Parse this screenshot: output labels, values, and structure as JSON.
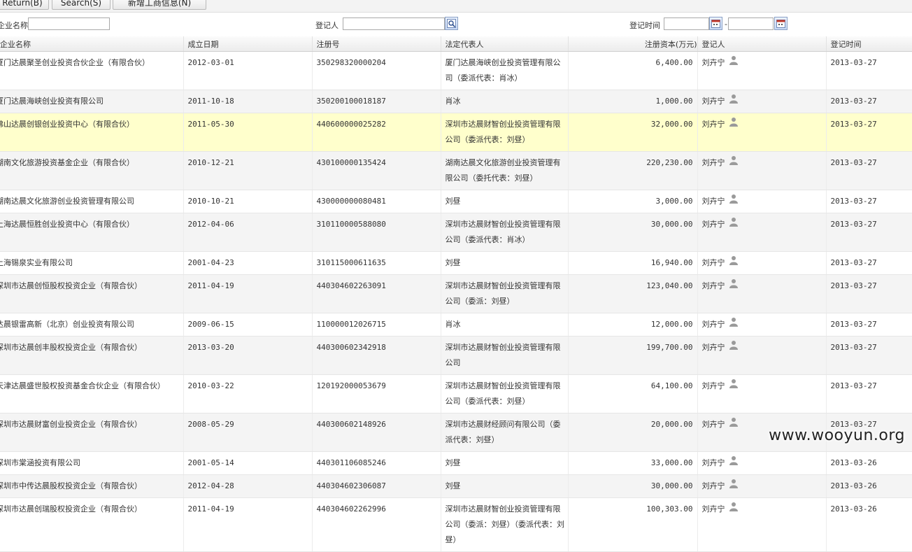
{
  "toolbar": {
    "return_label": "Return(B)",
    "search_label": "Search(S)",
    "add_label": "新增工商信息(N)"
  },
  "filters": {
    "company_label": "企业名称",
    "registrant_label": "登记人",
    "reg_time_label": "登记时间",
    "range_sep": "-"
  },
  "columns": [
    "企业名称",
    "成立日期",
    "注册号",
    "法定代表人",
    "注册资本(万元)",
    "登记人",
    "登记时间"
  ],
  "rows": [
    {
      "name": "厦门达晨聚圣创业投资合伙企业（有限合伙）",
      "date": "2012-03-01",
      "regno": "350298320000204",
      "rep": "厦门达晨海峡创业投资管理有限公司（委派代表：肖冰）",
      "capital": "6,400.00",
      "registrant": "刘卉宁",
      "time": "2013-03-27"
    },
    {
      "name": "厦门达晨海峡创业投资有限公司",
      "date": "2011-10-18",
      "regno": "350200100018187",
      "rep": "肖冰",
      "capital": "1,000.00",
      "registrant": "刘卉宁",
      "time": "2013-03-27"
    },
    {
      "name": "佛山达晨创银创业投资中心（有限合伙）",
      "date": "2011-05-30",
      "regno": "440600000025282",
      "rep": "深圳市达晨财智创业投资管理有限公司（委派代表：刘昼）",
      "capital": "32,000.00",
      "registrant": "刘卉宁",
      "time": "2013-03-27"
    },
    {
      "name": "湖南文化旅游投资基金企业（有限合伙）",
      "date": "2010-12-21",
      "regno": "430100000135424",
      "rep": "湖南达晨文化旅游创业投资管理有限公司（委托代表：刘昼）",
      "capital": "220,230.00",
      "registrant": "刘卉宁",
      "time": "2013-03-27"
    },
    {
      "name": "湖南达晨文化旅游创业投资管理有限公司",
      "date": "2010-10-21",
      "regno": "430000000080481",
      "rep": "刘昼",
      "capital": "3,000.00",
      "registrant": "刘卉宁",
      "time": "2013-03-27"
    },
    {
      "name": "上海达晨恒胜创业投资中心（有限合伙）",
      "date": "2012-04-06",
      "regno": "310110000588080",
      "rep": "深圳市达晨财智创业投资管理有限公司（委派代表：肖冰）",
      "capital": "30,000.00",
      "registrant": "刘卉宁",
      "time": "2013-03-27"
    },
    {
      "name": "上海锡泉实业有限公司",
      "date": "2001-04-23",
      "regno": "310115000611635",
      "rep": "刘昼",
      "capital": "16,940.00",
      "registrant": "刘卉宁",
      "time": "2013-03-27"
    },
    {
      "name": "深圳市达晨创恒股权投资企业（有限合伙）",
      "date": "2011-04-19",
      "regno": "440304602263091",
      "rep": "深圳市达晨财智创业投资管理有限公司（委派：刘昼）",
      "capital": "123,040.00",
      "registrant": "刘卉宁",
      "time": "2013-03-27"
    },
    {
      "name": "达晨银雷高新（北京）创业投资有限公司",
      "date": "2009-06-15",
      "regno": "110000012026715",
      "rep": "肖冰",
      "capital": "12,000.00",
      "registrant": "刘卉宁",
      "time": "2013-03-27"
    },
    {
      "name": "深圳市达晨创丰股权投资企业（有限合伙）",
      "date": "2013-03-20",
      "regno": "440300602342918",
      "rep": "深圳市达晨财智创业投资管理有限公司",
      "capital": "199,700.00",
      "registrant": "刘卉宁",
      "time": "2013-03-27"
    },
    {
      "name": "天津达晨盛世股权投资基金合伙企业（有限合伙）",
      "date": "2010-03-22",
      "regno": "120192000053679",
      "rep": "深圳市达晨财智创业投资管理有限公司（委派代表：刘昼）",
      "capital": "64,100.00",
      "registrant": "刘卉宁",
      "time": "2013-03-27"
    },
    {
      "name": "深圳市达晨财富创业投资企业（有限合伙）",
      "date": "2008-05-29",
      "regno": "440300602148926",
      "rep": "深圳市达晨财经顾问有限公司（委派代表：刘昼）",
      "capital": "20,000.00",
      "registrant": "刘卉宁",
      "time": "2013-03-27"
    },
    {
      "name": "深圳市棠涵投资有限公司",
      "date": "2001-05-14",
      "regno": "440301106085246",
      "rep": "刘昼",
      "capital": "33,000.00",
      "registrant": "刘卉宁",
      "time": "2013-03-26"
    },
    {
      "name": "深圳市中传达晨股权投资企业（有限合伙）",
      "date": "2012-04-28",
      "regno": "440304602306087",
      "rep": "刘昼",
      "capital": "30,000.00",
      "registrant": "刘卉宁",
      "time": "2013-03-26"
    },
    {
      "name": "深圳市达晨创瑞股权投资企业（有限合伙）",
      "date": "2011-04-19",
      "regno": "440304602262996",
      "rep": "深圳市达晨财智创业投资管理有限公司（委派：刘昼）（委派代表：刘昼）",
      "capital": "100,303.00",
      "registrant": "刘卉宁",
      "time": "2013-03-26"
    }
  ],
  "watermark": "www.wooyun.org"
}
